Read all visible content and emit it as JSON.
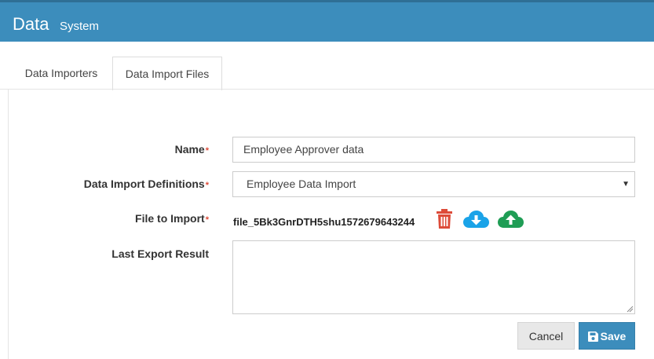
{
  "header": {
    "title": "Data",
    "subtitle": "System"
  },
  "tabs": [
    {
      "label": "Data Importers",
      "active": false
    },
    {
      "label": "Data Import Files",
      "active": true
    }
  ],
  "form": {
    "name_label": "Name",
    "name_value": "Employee Approver data",
    "definitions_label": "Data Import Definitions",
    "definitions_value": "Employee Data Import",
    "file_label": "File to Import",
    "file_name": "file_5Bk3GnrDTH5shu1572679643244",
    "result_label": "Last Export Result",
    "result_value": "",
    "required_marker": "*"
  },
  "actions": {
    "cancel_label": "Cancel",
    "save_label": "Save"
  },
  "icons": {
    "delete": "trash-icon",
    "download": "cloud-download-icon",
    "upload": "cloud-upload-icon",
    "save": "floppy-icon"
  },
  "colors": {
    "header": "#3c8dbc",
    "required": "#dd4b39",
    "delete": "#dd4b39",
    "download": "#1aa3e8",
    "upload": "#1f9d55"
  }
}
